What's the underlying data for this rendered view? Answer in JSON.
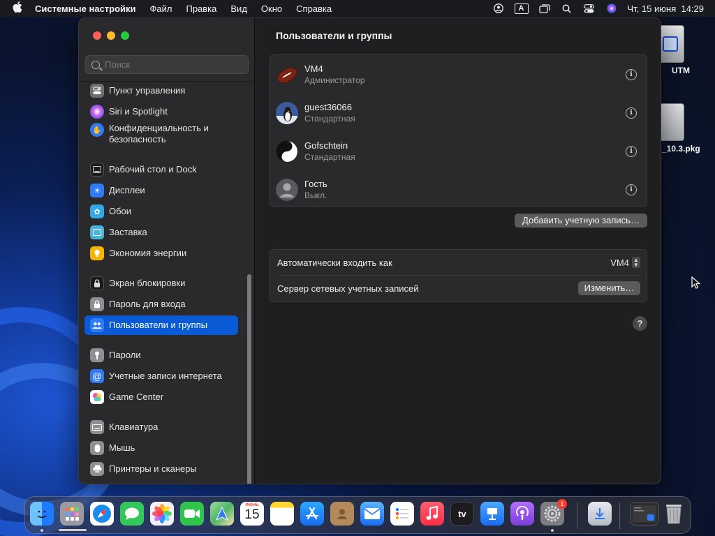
{
  "menubar": {
    "app_name": "Системные настройки",
    "menus": [
      "Файл",
      "Правка",
      "Вид",
      "Окно",
      "Справка"
    ],
    "input_indicator": "A",
    "clock": "Чт, 15 июня  14:29"
  },
  "desktop": {
    "icons": [
      {
        "label": "UTM"
      },
      {
        "label": "_10.3.pkg"
      }
    ]
  },
  "sidebar": {
    "search_placeholder": "Поиск",
    "items": [
      {
        "label": "Пункт управления",
        "icon": "control-center-icon",
        "color": "#6e6e73"
      },
      {
        "label": "Siri и Spotlight",
        "icon": "siri-icon",
        "color": "#8a3fc7"
      },
      {
        "label": "Конфиденциальность и безопасность",
        "icon": "privacy-hand-icon",
        "color": "#2f7bf6"
      },
      {
        "label": "Рабочий стол и Dock",
        "icon": "desktop-dock-icon",
        "color": "#1c1c1e"
      },
      {
        "label": "Дисплеи",
        "icon": "display-sun-icon",
        "color": "#2f7bf6"
      },
      {
        "label": "Обои",
        "icon": "wallpaper-flower-icon",
        "color": "#32a8e6"
      },
      {
        "label": "Заставка",
        "icon": "screensaver-icon",
        "color": "#4ab5d8"
      },
      {
        "label": "Экономия энергии",
        "icon": "energy-bulb-icon",
        "color": "#f5b400"
      },
      {
        "label": "Экран блокировки",
        "icon": "lock-icon",
        "color": "#1c1c1e"
      },
      {
        "label": "Пароль для входа",
        "icon": "login-password-lock-icon",
        "color": "#8e8e93"
      },
      {
        "label": "Пользователи и группы",
        "icon": "users-groups-icon",
        "color": "#2f7bf6"
      },
      {
        "label": "Пароли",
        "icon": "key-icon",
        "color": "#8e8e93"
      },
      {
        "label": "Учетные записи интернета",
        "icon": "at-sign-icon",
        "color": "#2f7bf6"
      },
      {
        "label": "Game Center",
        "icon": "game-center-icon",
        "color": "#ffffff"
      },
      {
        "label": "Клавиатура",
        "icon": "keyboard-icon",
        "color": "#8e8e93"
      },
      {
        "label": "Мышь",
        "icon": "mouse-icon",
        "color": "#8e8e93"
      },
      {
        "label": "Принтеры и сканеры",
        "icon": "printer-icon",
        "color": "#8e8e93"
      }
    ]
  },
  "main": {
    "title": "Пользователи и группы",
    "users": [
      {
        "name": "VM4",
        "role": "Администратор",
        "avatar": "football-avatar-icon"
      },
      {
        "name": "guest36066",
        "role": "Стандартная",
        "avatar": "penguin-avatar-icon"
      },
      {
        "name": "Gofschtein",
        "role": "Стандартная",
        "avatar": "yin-yang-avatar-icon"
      },
      {
        "name": "Гость",
        "role": "Выкл.",
        "avatar": "guest-avatar-icon"
      }
    ],
    "info_glyph": "i",
    "add_account_label": "Добавить учетную запись…",
    "auto_login_label": "Автоматически входить как",
    "auto_login_value": "VM4",
    "network_server_label": "Сервер сетевых учетных записей",
    "change_label": "Изменить…",
    "help_glyph": "?"
  },
  "dock": {
    "apps": [
      {
        "name": "Finder",
        "icon": "finder-icon",
        "color": "#1e90ff"
      },
      {
        "name": "Launchpad",
        "icon": "launchpad-icon",
        "color": "#9a9aa0"
      },
      {
        "name": "Safari",
        "icon": "safari-icon",
        "color": "#1a8cf0"
      },
      {
        "name": "Messages",
        "icon": "messages-icon",
        "color": "#34c759"
      },
      {
        "name": "Photos",
        "icon": "photos-icon",
        "color": "#f2f2f2"
      },
      {
        "name": "FaceTime",
        "icon": "facetime-icon",
        "color": "#2fc54a"
      },
      {
        "name": "Maps",
        "icon": "maps-icon",
        "color": "#4fb36a"
      },
      {
        "name": "Calendar",
        "icon": "calendar-icon",
        "color": "#ffffff",
        "month": "ИЮНЬ",
        "day": "15"
      },
      {
        "name": "Notes",
        "icon": "notes-icon",
        "color": "#ffd52e"
      },
      {
        "name": "App Store",
        "icon": "app-store-icon",
        "color": "#1a8cf0"
      },
      {
        "name": "Contacts",
        "icon": "contacts-icon",
        "color": "#b48a5a"
      },
      {
        "name": "Mail",
        "icon": "mail-icon",
        "color": "#2f8cf6"
      },
      {
        "name": "Reminders",
        "icon": "reminders-icon",
        "color": "#ffffff"
      },
      {
        "name": "Music",
        "icon": "music-icon",
        "color": "#fa2d48"
      },
      {
        "name": "TV",
        "icon": "apple-tv-icon",
        "color": "#1c1c1e",
        "text": "tv"
      },
      {
        "name": "Keynote",
        "icon": "keynote-icon",
        "color": "#2f8cf6"
      },
      {
        "name": "Podcasts",
        "icon": "podcasts-icon",
        "color": "#8e4fd8"
      },
      {
        "name": "System Settings",
        "icon": "system-settings-gear-icon",
        "color": "#7d7d82",
        "badge": "1"
      },
      {
        "name": "Downloads",
        "icon": "downloads-folder-icon",
        "color": "#c8ccd2"
      },
      {
        "name": "Screenshot",
        "icon": "screenshot-thumbnail-icon",
        "color": "#2c2c2e"
      },
      {
        "name": "Trash",
        "icon": "trash-icon",
        "color": "#b8b8bc"
      }
    ]
  }
}
